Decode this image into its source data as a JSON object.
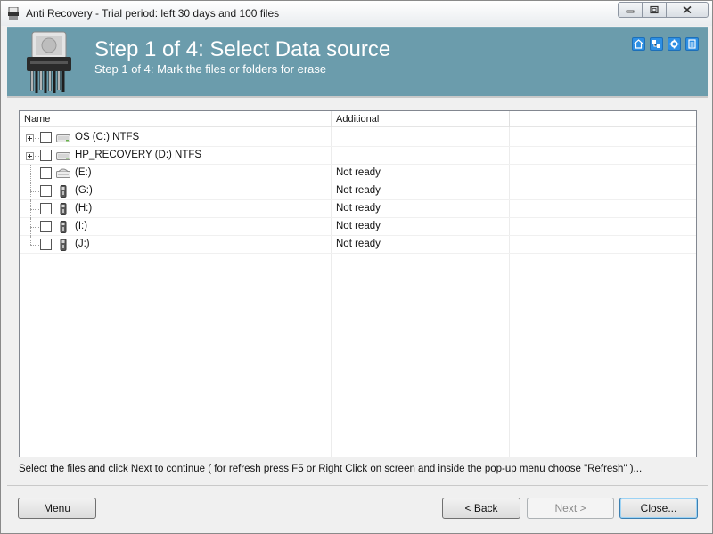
{
  "window": {
    "title": "Anti Recovery - Trial period: left 30 days and 100 files",
    "app_icon": "shredder-icon"
  },
  "header": {
    "step_title": "Step 1 of 4: Select Data source",
    "step_subtitle": "Step 1 of 4: Mark the files or folders for erase",
    "icons": [
      "home-icon",
      "network-icon",
      "settings-icon",
      "document-icon"
    ],
    "background_color": "#6b9cac"
  },
  "list": {
    "columns": [
      "Name",
      "Additional",
      ""
    ],
    "rows": [
      {
        "label": "OS (C:) NTFS",
        "additional": "",
        "icon": "hard-drive-icon",
        "expandable": true,
        "checked": false
      },
      {
        "label": "HP_RECOVERY (D:) NTFS",
        "additional": "",
        "icon": "hard-drive-icon",
        "expandable": true,
        "checked": false
      },
      {
        "label": "(E:)",
        "additional": "Not ready",
        "icon": "optical-drive-icon",
        "expandable": false,
        "checked": false
      },
      {
        "label": "(G:)",
        "additional": "Not ready",
        "icon": "usb-drive-icon",
        "expandable": false,
        "checked": false
      },
      {
        "label": "(H:)",
        "additional": "Not ready",
        "icon": "usb-drive-icon",
        "expandable": false,
        "checked": false
      },
      {
        "label": "(I:)",
        "additional": "Not ready",
        "icon": "usb-drive-icon",
        "expandable": false,
        "checked": false
      },
      {
        "label": "(J:)",
        "additional": "Not ready",
        "icon": "usb-drive-icon",
        "expandable": false,
        "checked": false
      }
    ]
  },
  "hint": "Select the files and click Next to continue ( for refresh press F5 or Right Click on screen and inside the pop-up menu choose \"Refresh\" )...",
  "buttons": {
    "menu": "Menu",
    "back": "< Back",
    "next": "Next >",
    "close": "Close..."
  }
}
